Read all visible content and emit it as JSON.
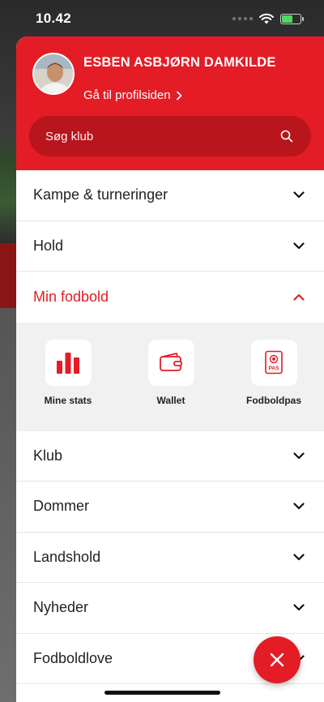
{
  "status_bar": {
    "time": "10.42"
  },
  "colors": {
    "brand_red": "#e31c25",
    "search_bg": "#b8151c",
    "submenu_bg": "#f1f1f1"
  },
  "profile": {
    "name": "ESBEN ASBJØRN DAMKILDE",
    "link_label": "Gå til profilsiden",
    "link_icon": "chevron-right-icon"
  },
  "search": {
    "placeholder": "Søg klub",
    "icon": "search-icon"
  },
  "menu": {
    "items": [
      {
        "label": "Kampe & turneringer",
        "icon": "chevron-down-icon"
      },
      {
        "label": "Hold",
        "icon": "chevron-down-icon"
      },
      {
        "label": "Min fodbold",
        "icon": "chevron-up-icon",
        "expanded": true
      },
      {
        "label": "Klub",
        "icon": "chevron-down-icon"
      },
      {
        "label": "Dommer",
        "icon": "chevron-down-icon"
      },
      {
        "label": "Landshold",
        "icon": "chevron-down-icon"
      },
      {
        "label": "Nyheder",
        "icon": "chevron-down-icon"
      },
      {
        "label": "Fodboldlove",
        "icon": "chevron-down-icon"
      }
    ],
    "min_fodbold_items": [
      {
        "label": "Mine stats",
        "icon": "bar-chart-icon"
      },
      {
        "label": "Wallet",
        "icon": "wallet-icon"
      },
      {
        "label": "Fodboldpas",
        "icon": "football-pass-icon",
        "badge_text": "PAS"
      }
    ]
  },
  "fab": {
    "icon": "close-icon"
  }
}
